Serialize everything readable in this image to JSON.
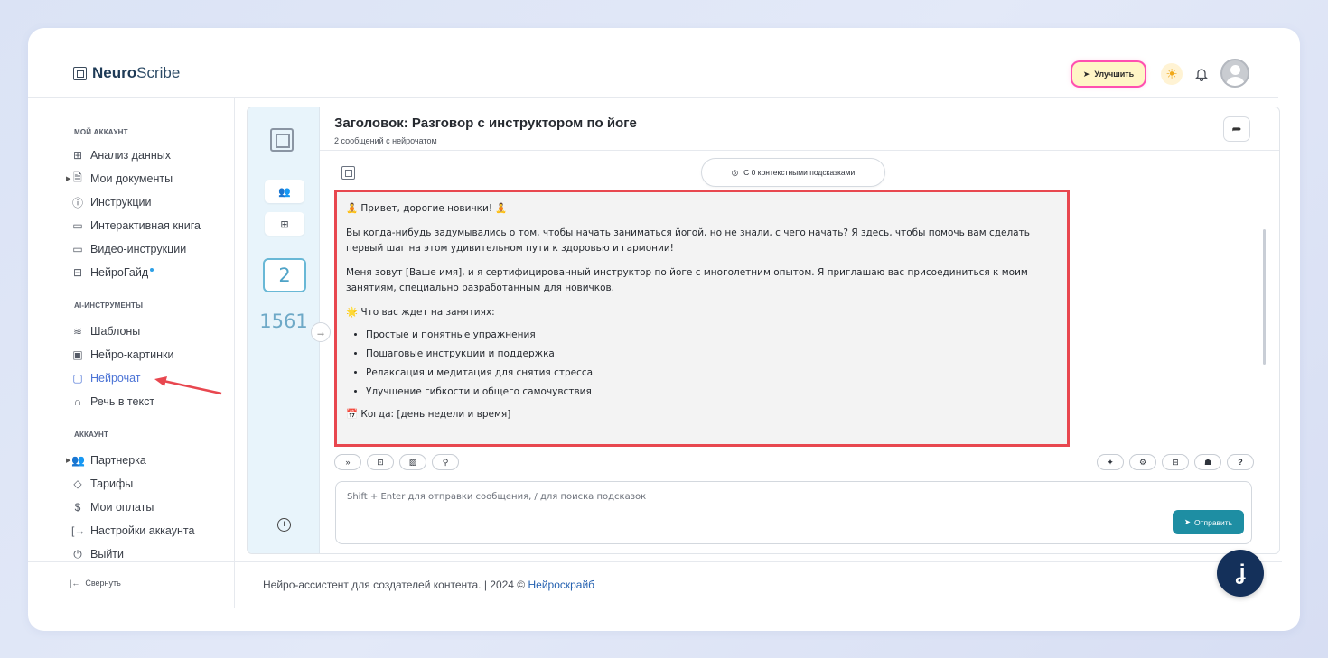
{
  "brand": {
    "bold": "Neuro",
    "thin": "Scribe"
  },
  "topbar": {
    "upgrade_label": "Улучшить"
  },
  "sidebar": {
    "sections": [
      {
        "title": "МОЙ АККАУНТ"
      },
      {
        "title": "AI-ИНСТРУМЕНТЫ"
      },
      {
        "title": "АККАУНТ"
      }
    ],
    "items": [
      {
        "label": "Анализ данных",
        "icon": "grid-icon"
      },
      {
        "label": "Мои документы",
        "icon": "document-icon"
      },
      {
        "label": "Инструкции",
        "icon": "question-icon"
      },
      {
        "label": "Интерактивная книга",
        "icon": "book-icon"
      },
      {
        "label": "Видео-инструкции",
        "icon": "video-icon"
      },
      {
        "label": "НейроГайд",
        "icon": "table-icon"
      },
      {
        "label": "Шаблоны",
        "icon": "layers-icon"
      },
      {
        "label": "Нейро-картинки",
        "icon": "image-icon"
      },
      {
        "label": "Нейрочат",
        "icon": "chat-icon"
      },
      {
        "label": "Речь в текст",
        "icon": "headphones-icon"
      },
      {
        "label": "Партнерка",
        "icon": "users-icon"
      },
      {
        "label": "Тарифы",
        "icon": "tag-icon"
      },
      {
        "label": "Мои оплаты",
        "icon": "dollar-icon"
      },
      {
        "label": "Настройки аккаунта",
        "icon": "login-icon"
      },
      {
        "label": "Выйти",
        "icon": "power-icon"
      }
    ],
    "collapse_label": "Свернуть"
  },
  "chat": {
    "title": "Заголовок: Разговор с инструктором по йоге",
    "subtitle": "2 сообщений с нейрочатом",
    "message_count": "2",
    "token_count": "1561",
    "hints_label": "С 0 контекстными подсказками",
    "message": {
      "greeting": "🧘 Привет, дорогие новички! 🧘",
      "p1": "Вы когда-нибудь задумывались о том, чтобы начать заниматься йогой, но не знали, с чего начать? Я здесь, чтобы помочь вам сделать первый шаг на этом удивительном пути к здоровью и гармонии!",
      "p2": "Меня зовут [Ваше имя], и я сертифицированный инструктор по йоге с многолетним опытом. Я приглашаю вас присоединиться к моим занятиям, специально разработанным для новичков.",
      "list_title": "🌟 Что вас ждет на занятиях:",
      "list": [
        "Простые и понятные упражнения",
        "Пошаговые инструкции и поддержка",
        "Релаксация и медитация для снятия стресса",
        "Улучшение гибкости и общего самочувствия"
      ],
      "when": "📅 Когда: [день недели и время]"
    },
    "input_placeholder": "Shift + Enter для отправки сообщения, / для поиска подсказок",
    "send_label": "Отправить"
  },
  "footer": {
    "text": "Нейро-ассистент для создателей контента.  | 2024 © ",
    "link": "Нейроскрайб"
  },
  "colors": {
    "accent": "#1e8ea3",
    "annotation": "#e8474f",
    "active_nav": "#4b73d6"
  }
}
